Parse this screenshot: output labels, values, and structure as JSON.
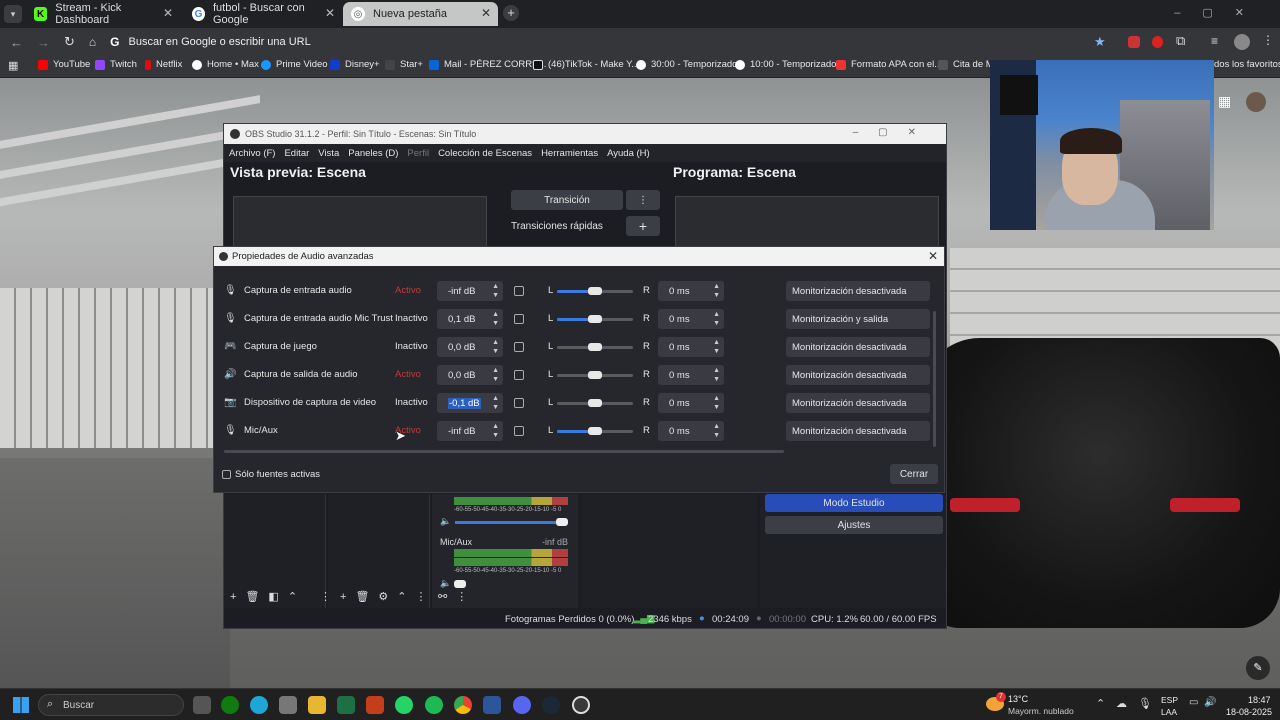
{
  "browser": {
    "tabs": [
      {
        "label": "Stream - Kick Dashboard",
        "fav": "K",
        "color": "#53fc18"
      },
      {
        "label": "futbol - Buscar con Google",
        "fav": "G",
        "color": "#ffffff"
      },
      {
        "label": "Nueva pestaña",
        "fav": "◎",
        "color": "#ffffff"
      }
    ],
    "address_placeholder": "Buscar en Google o escribir una URL",
    "bookmarks": [
      "YouTube",
      "Twitch",
      "Netflix",
      "Home • Max",
      "Prime Video",
      "Disney+",
      "Star+",
      "Mail - PÉREZ CORRE...",
      "(46)TikTok - Make Y...",
      "30:00 - Temporizador",
      "10:00 - Temporizador",
      "Formato APA con el...",
      "Cita de Me"
    ],
    "all_bookmarks": "dos los favoritos"
  },
  "obs": {
    "title": "OBS Studio 31.1.2 - Perfil: Sin Título - Escenas: Sin Título",
    "menu": [
      "Archivo (F)",
      "Editar",
      "Vista",
      "Paneles (D)",
      "Perfil",
      "Colección de Escenas",
      "Herramientas",
      "Ayuda (H)"
    ],
    "preview_label": "Vista previa: Escena",
    "program_label": "Programa: Escena",
    "transition_button": "Transición",
    "quick_transitions": "Transiciones rápidas",
    "studio_mode": "Modo Estudio",
    "settings": "Ajustes",
    "mixer_source": "Mic/Aux",
    "mixer_level": "-inf dB",
    "meter_scale": "-60-55-50-45-40-35-30-25-20-15-10 -5  0",
    "status": {
      "dropped": "Fotogramas Perdidos 0 (0.0%)",
      "bitrate": "2346 kbps",
      "rec_time": "00:24:09",
      "stream_time": "00:00:00",
      "cpu": "CPU: 1.2%",
      "fps": "60.00 / 60.00 FPS"
    }
  },
  "dialog": {
    "title": "Propiedades de Audio avanzadas",
    "rows": [
      {
        "icon": "mic",
        "name": "Captura de entrada audio",
        "status": "Activo",
        "active": true,
        "volume": "-inf dB",
        "balance": 0.5,
        "fill": 0.5,
        "sync": "0 ms",
        "monitor": "Monitorización desactivada"
      },
      {
        "icon": "mic",
        "name": "Captura de entrada audio Mic Trust",
        "status": "Inactivo",
        "active": false,
        "volume": "0,1 dB",
        "balance": 0.5,
        "fill": 0.5,
        "sync": "0 ms",
        "monitor": "Monitorización y salida"
      },
      {
        "icon": "gamepad",
        "name": "Captura de juego",
        "status": "Inactivo",
        "active": false,
        "volume": "0,0 dB",
        "balance": 0.5,
        "fill": 0,
        "sync": "0 ms",
        "monitor": "Monitorización desactivada"
      },
      {
        "icon": "speaker",
        "name": "Captura de salida de audio",
        "status": "Activo",
        "active": true,
        "volume": "0,0 dB",
        "balance": 0.5,
        "fill": 0,
        "sync": "0 ms",
        "monitor": "Monitorización desactivada"
      },
      {
        "icon": "camera",
        "name": "Dispositivo de captura de video",
        "status": "Inactivo",
        "active": false,
        "volume": "-0,1 dB",
        "selected": "-0,1",
        "balance": 0.5,
        "fill": 0,
        "sync": "0 ms",
        "monitor": "Monitorización desactivada"
      },
      {
        "icon": "mic",
        "name": "Mic/Aux",
        "status": "Activo",
        "active": true,
        "volume": "-inf dB",
        "balance": 0.5,
        "fill": 0.5,
        "sync": "0 ms",
        "monitor": "Monitorización desactivada"
      }
    ],
    "only_active": "Sólo fuentes activas",
    "close": "Cerrar",
    "L": "L",
    "R": "R"
  },
  "taskbar": {
    "search": "Buscar",
    "weather_temp": "13°C",
    "weather_desc": "Mayorm. nublado",
    "lang1": "ESP",
    "lang2": "LAA",
    "time": "18:47",
    "date": "18-08-2025",
    "badge_weather": "7"
  }
}
